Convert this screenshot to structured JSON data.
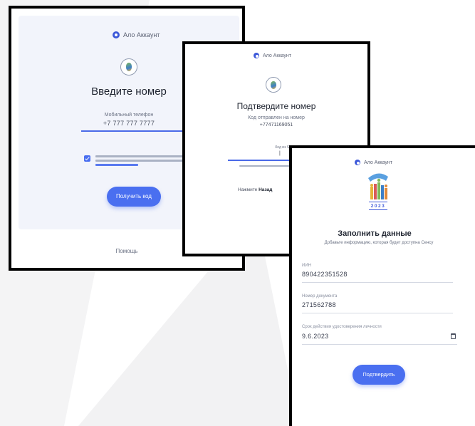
{
  "brand": {
    "name": "Ало Аккаунт"
  },
  "screen1": {
    "title": "Введите номер",
    "field_label": "Мобильный телефон",
    "phone_value": "+7 777 777 7777",
    "consent_checked": true,
    "button_label": "Получить код",
    "footer_label": "Помощь"
  },
  "screen2": {
    "title": "Подтвердите номер",
    "subtitle": "Код отправлен на номер",
    "phone": "+77471169051",
    "code_label": "Код из SMS",
    "resend_prefix": "Нажмите",
    "resend_link": "Назад"
  },
  "screen3": {
    "title": "Заполнить данные",
    "subtitle": "Добавьте информацию, которая будет доступна Сенсу",
    "fields": [
      {
        "label": "ИИН",
        "value": "890422351528"
      },
      {
        "label": "Номер документа",
        "value": "271562788"
      },
      {
        "label": "Срок действия удостоверения личности",
        "value": "9.6.2023"
      }
    ],
    "logo_year": "2023",
    "button_label": "Подтвердить"
  },
  "colors": {
    "accent": "#4a6ff0",
    "frame": "#000000",
    "panel": "#f2f4fb"
  }
}
